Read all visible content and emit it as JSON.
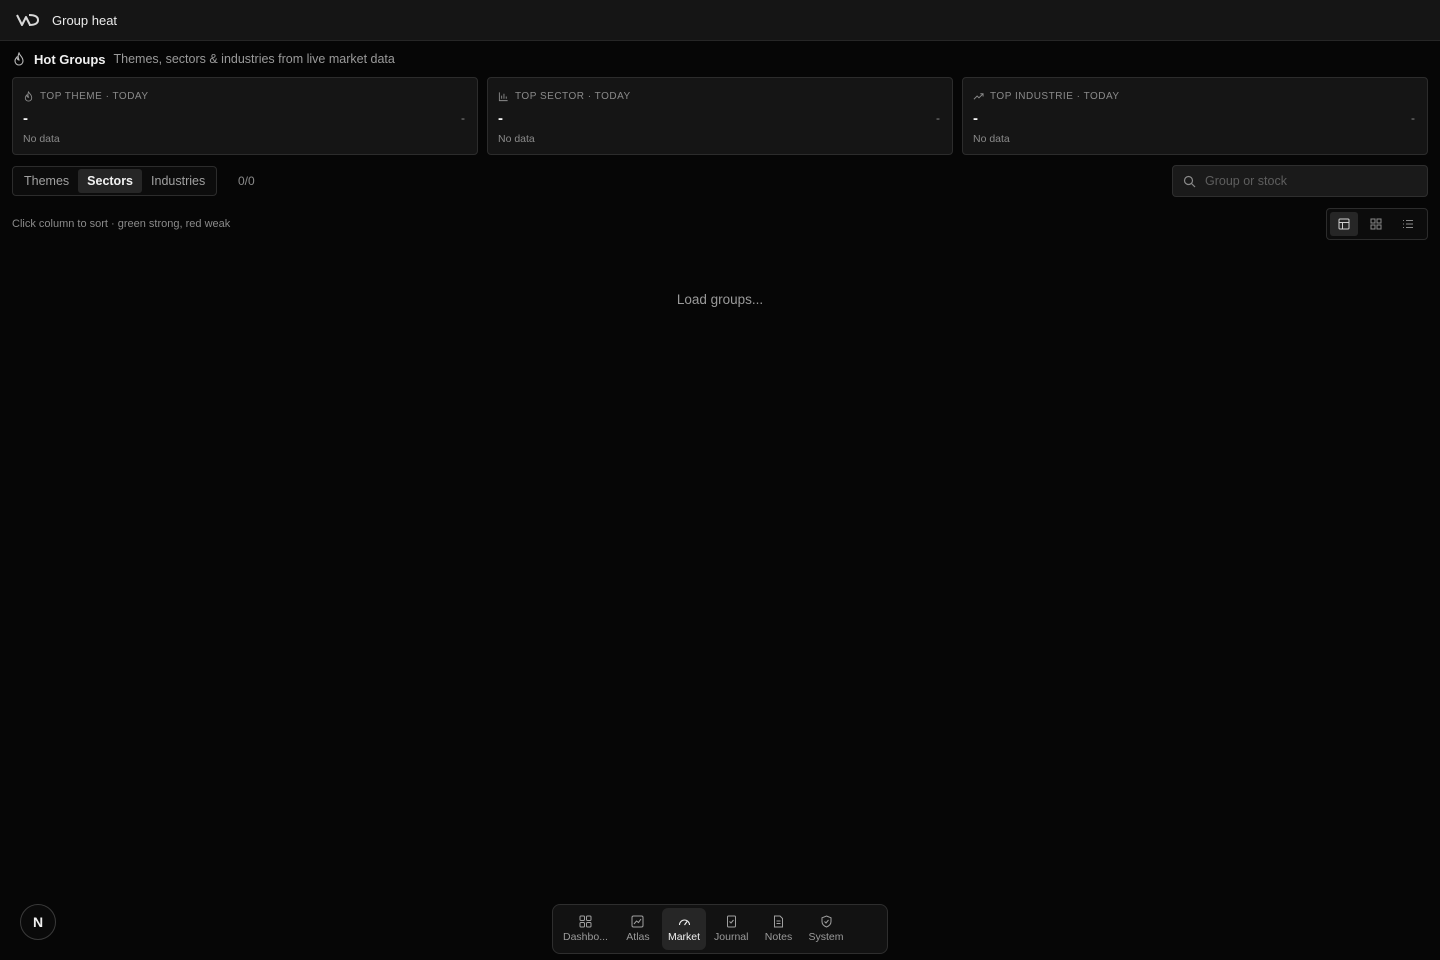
{
  "topbar": {
    "title": "Group heat"
  },
  "header": {
    "title": "Hot Groups",
    "subtitle": "Themes, sectors & industries from live market data"
  },
  "cards": [
    {
      "label": "TOP THEME · TODAY",
      "value": "-",
      "change": "-",
      "note": "No data",
      "icon": "flame-icon"
    },
    {
      "label": "TOP SECTOR · TODAY",
      "value": "-",
      "change": "-",
      "note": "No data",
      "icon": "bar-chart-icon"
    },
    {
      "label": "TOP INDUSTRIE · TODAY",
      "value": "-",
      "change": "-",
      "note": "No data",
      "icon": "trending-up-icon"
    }
  ],
  "tabs": [
    {
      "label": "Themes",
      "active": false
    },
    {
      "label": "Sectors",
      "active": true
    },
    {
      "label": "Industries",
      "active": false
    }
  ],
  "count": "0/0",
  "search": {
    "placeholder": "Group or stock",
    "value": ""
  },
  "hint": "Click column to sort · green strong, red weak",
  "view_modes": [
    {
      "icon": "table-view-icon",
      "active": true
    },
    {
      "icon": "grid-view-icon",
      "active": false
    },
    {
      "icon": "list-view-icon",
      "active": false
    }
  ],
  "loading": "Load groups...",
  "avatar": {
    "initial": "N"
  },
  "dock": [
    {
      "label": "Dashbo...",
      "icon": "dashboard-icon",
      "active": false
    },
    {
      "label": "Atlas",
      "icon": "chart-icon",
      "active": false
    },
    {
      "label": "Market",
      "icon": "gauge-icon",
      "active": true
    },
    {
      "label": "Journal",
      "icon": "journal-icon",
      "active": false
    },
    {
      "label": "Notes",
      "icon": "notes-icon",
      "active": false
    },
    {
      "label": "System",
      "icon": "shield-icon",
      "active": false
    }
  ]
}
